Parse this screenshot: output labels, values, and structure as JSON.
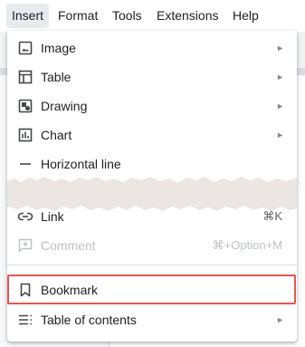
{
  "menubar": {
    "items": [
      {
        "label": "Insert",
        "active": true
      },
      {
        "label": "Format"
      },
      {
        "label": "Tools"
      },
      {
        "label": "Extensions"
      },
      {
        "label": "Help"
      }
    ]
  },
  "menu": {
    "items": [
      {
        "label": "Image",
        "icon": "image-icon",
        "submenu": true
      },
      {
        "label": "Table",
        "icon": "table-icon",
        "submenu": true
      },
      {
        "label": "Drawing",
        "icon": "drawing-icon",
        "submenu": true
      },
      {
        "label": "Chart",
        "icon": "chart-icon",
        "submenu": true
      },
      {
        "label": "Horizontal line",
        "icon": "horizontal-line-icon"
      },
      {
        "label": "Link",
        "icon": "link-icon",
        "shortcut": "⌘K"
      },
      {
        "label": "Comment",
        "icon": "comment-add-icon",
        "shortcut": "⌘+Option+M",
        "disabled": true
      },
      {
        "label": "Bookmark",
        "icon": "bookmark-icon",
        "highlighted": true
      },
      {
        "label": "Table of contents",
        "icon": "table-of-contents-icon",
        "submenu": true
      }
    ],
    "submenu_arrow": "►"
  },
  "colors": {
    "highlight_border": "#e8534f",
    "text": "#202124",
    "disabled_text": "#bdc1c6"
  }
}
